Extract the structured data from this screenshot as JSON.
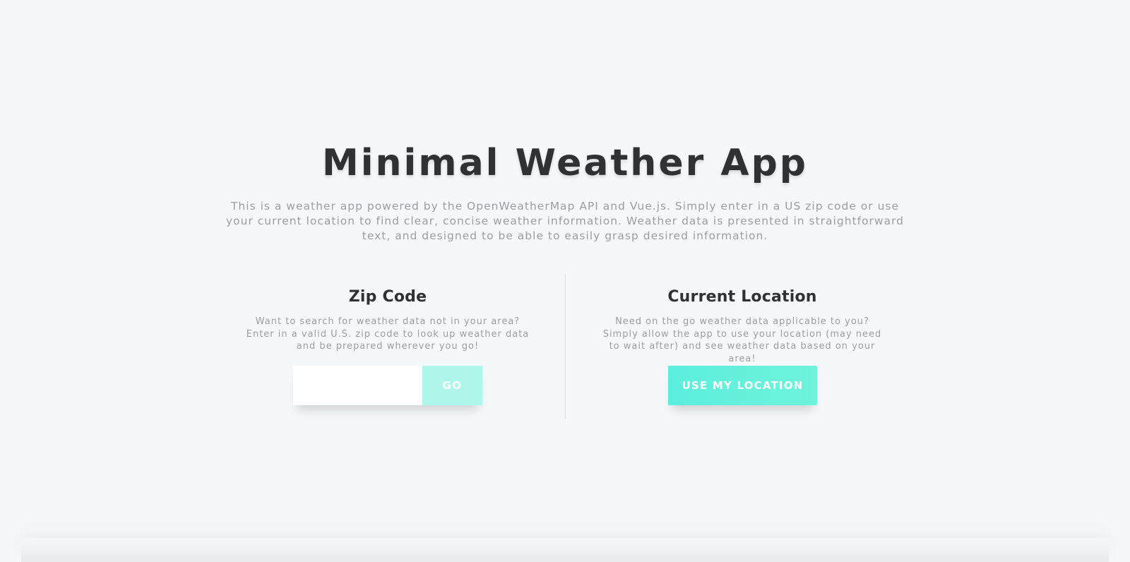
{
  "header": {
    "title": "Minimal Weather App",
    "intro": "This is a weather app powered by the OpenWeatherMap API and Vue.js. Simply enter in a US zip code or use your current location to find clear, concise weather information. Weather data is presented in straightforward text, and designed to be able to easily grasp desired information."
  },
  "zip_section": {
    "heading": "Zip Code",
    "description": "Want to search for weather data not in your area? Enter in a valid U.S. zip code to look up weather data and be prepared wherever you go!",
    "input_value": "",
    "go_label": "GO"
  },
  "location_section": {
    "heading": "Current Location",
    "description": "Need on the go weather data applicable to you? Simply allow the app to use your location (may need to wait after) and see weather data based on your area!",
    "button_label": "USE MY LOCATION"
  },
  "colors": {
    "background": "#f4f8fb",
    "accent": "#5ceedd",
    "go_button": "#aef6ea",
    "title_text": "#2f3234",
    "muted_text": "#9a9ea3"
  }
}
